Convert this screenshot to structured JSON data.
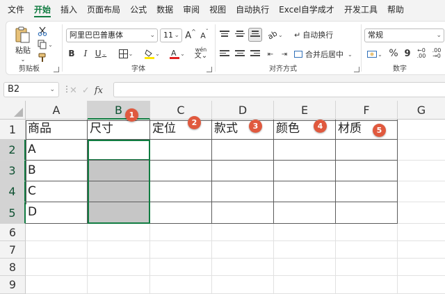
{
  "menu": {
    "tabs": [
      "文件",
      "开始",
      "插入",
      "页面布局",
      "公式",
      "数据",
      "审阅",
      "视图",
      "自动执行",
      "Excel自学成才",
      "开发工具",
      "帮助"
    ],
    "active": "开始"
  },
  "ribbon": {
    "clipboard": {
      "label": "剪贴板",
      "paste": "粘贴"
    },
    "font": {
      "label": "字体",
      "name": "阿里巴巴普惠体",
      "size": "11",
      "bold": "B",
      "italic": "I",
      "underline": "U",
      "grow": "A",
      "shrink": "A",
      "wen": "wén"
    },
    "alignment": {
      "label": "对齐方式",
      "wrap": "自动换行",
      "merge": "合并后居中"
    },
    "number": {
      "label": "数字",
      "format": "常规",
      "percent": "%",
      "comma": "9"
    }
  },
  "formula_bar": {
    "name_box": "B2",
    "cancel": "✕",
    "enter": "✓",
    "fx": "fx",
    "value": ""
  },
  "sheet": {
    "columns": [
      "A",
      "B",
      "C",
      "D",
      "E",
      "F",
      "G"
    ],
    "rows": [
      "1",
      "2",
      "3",
      "4",
      "5",
      "6",
      "7",
      "8",
      "9"
    ],
    "selected_column": "B",
    "selected_rows": [
      "2",
      "3",
      "4",
      "5"
    ],
    "active_cell": "B2",
    "headers": [
      "商品",
      "尺寸",
      "定位",
      "款式",
      "颜色",
      "材质"
    ],
    "items": [
      "A",
      "B",
      "C",
      "D"
    ],
    "badges": [
      "1",
      "2",
      "3",
      "4",
      "5"
    ],
    "colors": {
      "accent": "#107c41",
      "badge": "#e0593e",
      "fill_gray": "#c6c6c6"
    }
  }
}
